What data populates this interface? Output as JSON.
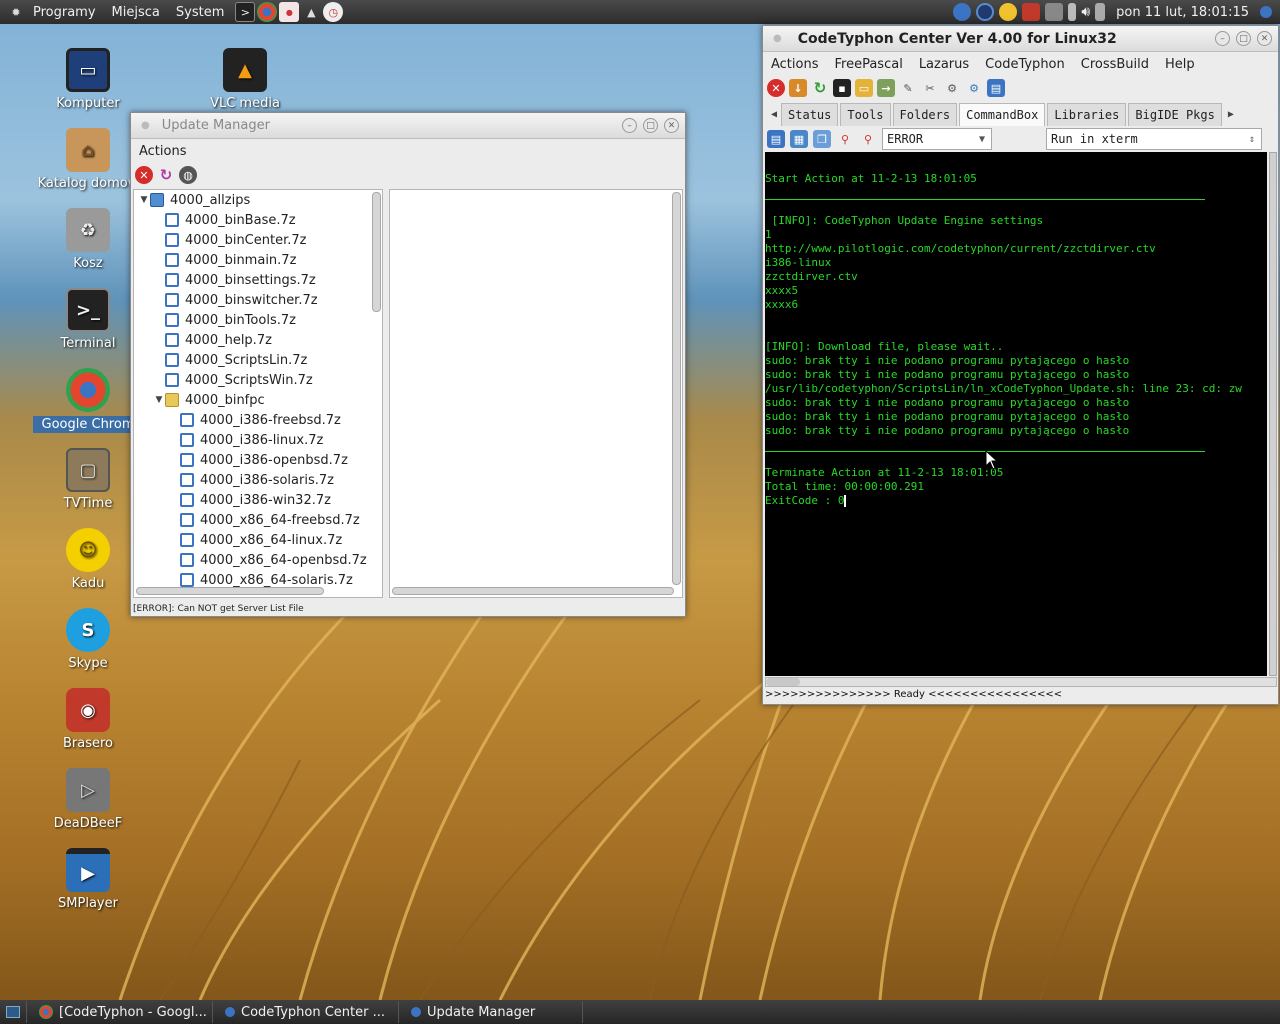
{
  "top_panel": {
    "menus": [
      "Programy",
      "Miejsca",
      "System"
    ],
    "clock": "pon 11 lut, 18:01:15"
  },
  "desktop_icons": [
    {
      "label": "Komputer"
    },
    {
      "label": "VLC media player"
    },
    {
      "label": "Katalog domow"
    },
    {
      "label": "Kosz"
    },
    {
      "label": "Terminal"
    },
    {
      "label": "Google Chrom"
    },
    {
      "label": "TVTime"
    },
    {
      "label": "Kadu"
    },
    {
      "label": "Skype"
    },
    {
      "label": "Brasero"
    },
    {
      "label": "DeaDBeeF"
    },
    {
      "label": "SMPlayer"
    }
  ],
  "update_manager": {
    "title": "Update Manager",
    "menu": [
      "Actions"
    ],
    "tree": [
      {
        "label": "4000_allzips",
        "level": 0,
        "expanded": true,
        "icon": "home"
      },
      {
        "label": "4000_binBase.7z",
        "level": 1,
        "icon": "package"
      },
      {
        "label": "4000_binCenter.7z",
        "level": 1,
        "icon": "package"
      },
      {
        "label": "4000_binmain.7z",
        "level": 1,
        "icon": "package"
      },
      {
        "label": "4000_binsettings.7z",
        "level": 1,
        "icon": "package"
      },
      {
        "label": "4000_binswitcher.7z",
        "level": 1,
        "icon": "package"
      },
      {
        "label": "4000_binTools.7z",
        "level": 1,
        "icon": "package"
      },
      {
        "label": "4000_help.7z",
        "level": 1,
        "icon": "package"
      },
      {
        "label": "4000_ScriptsLin.7z",
        "level": 1,
        "icon": "package"
      },
      {
        "label": "4000_ScriptsWin.7z",
        "level": 1,
        "icon": "package"
      },
      {
        "label": "4000_binfpc",
        "level": 1,
        "expanded": true,
        "icon": "folder"
      },
      {
        "label": "4000_i386-freebsd.7z",
        "level": 2,
        "icon": "package"
      },
      {
        "label": "4000_i386-linux.7z",
        "level": 2,
        "icon": "package"
      },
      {
        "label": "4000_i386-openbsd.7z",
        "level": 2,
        "icon": "package"
      },
      {
        "label": "4000_i386-solaris.7z",
        "level": 2,
        "icon": "package"
      },
      {
        "label": "4000_i386-win32.7z",
        "level": 2,
        "icon": "package"
      },
      {
        "label": "4000_x86_64-freebsd.7z",
        "level": 2,
        "icon": "package"
      },
      {
        "label": "4000_x86_64-linux.7z",
        "level": 2,
        "icon": "package"
      },
      {
        "label": "4000_x86_64-openbsd.7z",
        "level": 2,
        "icon": "package"
      },
      {
        "label": "4000_x86_64-solaris.7z",
        "level": 2,
        "icon": "package"
      }
    ],
    "status": "[ERROR]: Can NOT get Server List File"
  },
  "codetyphon": {
    "title": "CodeTyphon Center Ver 4.00 for Linux32",
    "menu": [
      "Actions",
      "FreePascal",
      "Lazarus",
      "CodeTyphon",
      "CrossBuild",
      "Help"
    ],
    "tabs": [
      "Status",
      "Tools",
      "Folders",
      "CommandBox",
      "Libraries",
      "BigIDE Pkgs"
    ],
    "active_tab": "CommandBox",
    "level_combo": "ERROR",
    "run_combo": "Run in xterm",
    "terminal_lines": [
      {
        "text": ""
      },
      {
        "text": "Start Action at 11-2-13 18:01:05"
      },
      {
        "sep": true
      },
      {
        "text": ""
      },
      {
        "text": " [INFO]: CodeTyphon Update Engine settings"
      },
      {
        "text": "1"
      },
      {
        "text": "http://www.pilotlogic.com/codetyphon/current/zzctdirver.ctv"
      },
      {
        "text": "i386-linux"
      },
      {
        "text": "zzctdirver.ctv"
      },
      {
        "text": "xxxx5"
      },
      {
        "text": "xxxx6"
      },
      {
        "text": ""
      },
      {
        "text": ""
      },
      {
        "text": "[INFO]: Download file, please wait.."
      },
      {
        "text": "sudo: brak tty i nie podano programu pytającego o hasło"
      },
      {
        "text": "sudo: brak tty i nie podano programu pytającego o hasło"
      },
      {
        "text": "/usr/lib/codetyphon/ScriptsLin/ln_xCodeTyphon_Update.sh: line 23: cd: zw"
      },
      {
        "text": "sudo: brak tty i nie podano programu pytającego o hasło"
      },
      {
        "text": "sudo: brak tty i nie podano programu pytającego o hasło"
      },
      {
        "text": "sudo: brak tty i nie podano programu pytającego o hasło"
      },
      {
        "sep": true
      },
      {
        "text": ""
      },
      {
        "text": "Terminate Action at 11-2-13 18:01:05"
      },
      {
        "text": "Total time: 00:00:00.291"
      },
      {
        "text": "ExitCode : 0",
        "cursor": true
      }
    ],
    "status": ">>>>>>>>>>>>>>> Ready <<<<<<<<<<<<<<<<"
  },
  "taskbar": [
    {
      "label": "[CodeTyphon - Googl...",
      "color": "#d9402f"
    },
    {
      "label": "CodeTyphon Center ...",
      "color": "#3b74c2"
    },
    {
      "label": "Update Manager",
      "color": "#3b74c2"
    }
  ]
}
